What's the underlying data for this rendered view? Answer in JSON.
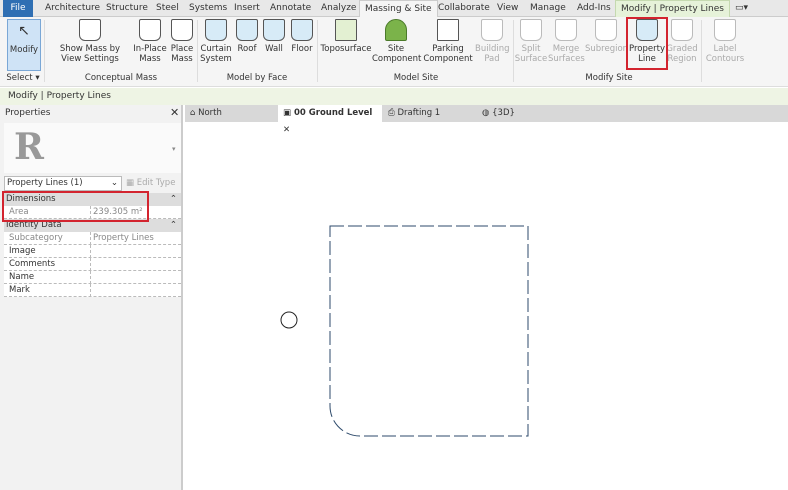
{
  "ribbon_tabs": [
    "File",
    "Architecture",
    "Structure",
    "Steel",
    "Systems",
    "Insert",
    "Annotate",
    "Analyze",
    "Massing & Site",
    "Collaborate",
    "View",
    "Manage",
    "Add-Ins",
    "Modify | Property Lines"
  ],
  "ribbon_buttons": [
    {
      "label": "Modify",
      "icon": "cursor-icon"
    },
    {
      "label": "Show Mass by View Settings",
      "icon": "mass-icon"
    },
    {
      "label": "In-Place Mass",
      "icon": "in-place-mass-icon"
    },
    {
      "label": "Place Mass",
      "icon": "place-mass-icon"
    },
    {
      "label": "Curtain System",
      "icon": "curtain-system-icon"
    },
    {
      "label": "Roof",
      "icon": "roof-icon"
    },
    {
      "label": "Wall",
      "icon": "wall-icon"
    },
    {
      "label": "Floor",
      "icon": "floor-icon"
    },
    {
      "label": "Toposurface",
      "icon": "toposurface-icon"
    },
    {
      "label": "Site Component",
      "icon": "tree-icon"
    },
    {
      "label": "Parking Component",
      "icon": "parking-icon"
    },
    {
      "label": "Building Pad",
      "icon": "building-pad-icon"
    },
    {
      "label": "Split Surface",
      "icon": "split-surface-icon"
    },
    {
      "label": "Merge Surfaces",
      "icon": "merge-surfaces-icon"
    },
    {
      "label": "Subregion",
      "icon": "subregion-icon"
    },
    {
      "label": "Property Line",
      "icon": "property-line-icon"
    },
    {
      "label": "Graded Region",
      "icon": "graded-region-icon"
    },
    {
      "label": "Label Contours",
      "icon": "label-contours-icon"
    }
  ],
  "panels": [
    "Select ▾",
    "Conceptual Mass",
    "Model by Face",
    "Model Site",
    "Modify Site"
  ],
  "context_bar": "Modify | Property Lines",
  "view_tabs": [
    "North",
    "00 Ground Level",
    "Drafting 1",
    "{3D}"
  ],
  "properties": {
    "title": "Properties",
    "type_selector": "Property Lines (1)",
    "edit_type": "Edit Type",
    "groups": [
      {
        "name": "Dimensions",
        "rows": [
          {
            "k": "Area",
            "v": "239.305 m²"
          }
        ]
      },
      {
        "name": "Identity Data",
        "rows": [
          {
            "k": "Subcategory",
            "v": "Property Lines"
          },
          {
            "k": "Image",
            "v": ""
          },
          {
            "k": "Comments",
            "v": ""
          },
          {
            "k": "Name",
            "v": ""
          },
          {
            "k": "Mark",
            "v": ""
          }
        ]
      }
    ]
  },
  "colors": {
    "file_tab": "#2f6fb3",
    "highlight": "#d3242f",
    "context_bar": "#eef4e4",
    "line": "#2d4a6b"
  }
}
